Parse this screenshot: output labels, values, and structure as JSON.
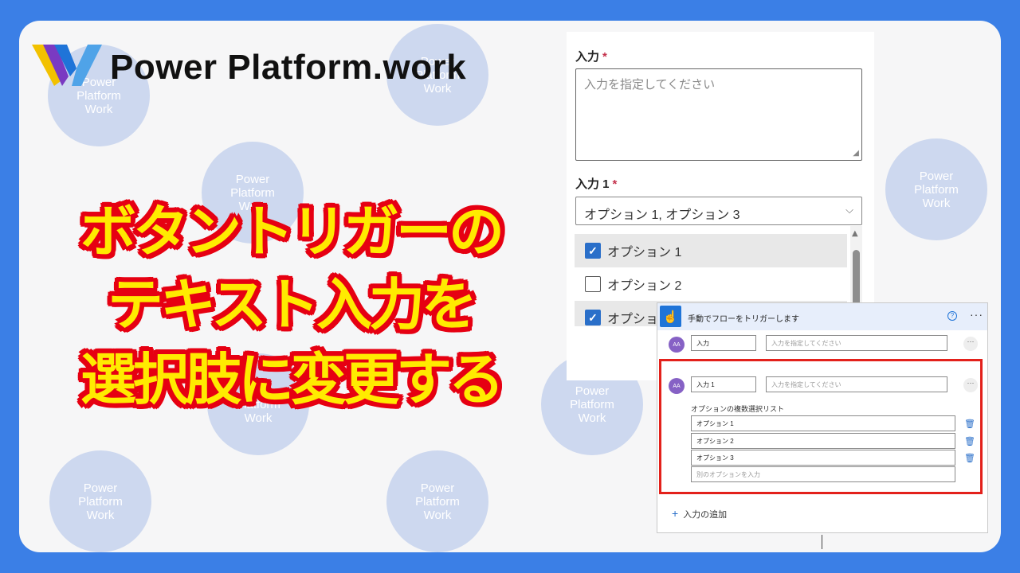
{
  "branding": {
    "site_name": "Power Platform.work",
    "bubble_text": "Power\nPlatform\nWork"
  },
  "headline": {
    "line1": "ボタントリガーの",
    "line2": "テキスト入力を",
    "line3": "選択肢に変更する"
  },
  "form_preview": {
    "field1_label": "入力",
    "field1_required": "*",
    "field1_placeholder": "入力を指定してください",
    "field2_label": "入力 1",
    "field2_required": "*",
    "field2_value": "オプション 1, オプション 3",
    "options": [
      {
        "label": "オプション 1",
        "checked": true
      },
      {
        "label": "オプション 2",
        "checked": false
      },
      {
        "label": "オプション 3",
        "checked": true
      }
    ]
  },
  "trigger_card": {
    "title": "手動でフローをトリガーします",
    "help_icon": "?",
    "more": "···",
    "input1": {
      "avatar": "AA",
      "name": "入力",
      "placeholder": "入力を指定してください"
    },
    "input2": {
      "avatar": "AA",
      "name": "入力 1",
      "placeholder": "入力を指定してください"
    },
    "option_list_label": "オプションの複数選択リスト",
    "option_items": [
      "オプション 1",
      "オプション 2",
      "オプション 3"
    ],
    "new_option_placeholder": "別のオプションを入力",
    "add_input_label": "入力の追加",
    "add_icon": "+"
  },
  "colors": {
    "frame_blue": "#3b7fe6",
    "headline_yellow": "#ffeb00",
    "headline_outline": "#e60012",
    "highlight_red": "#e3211b",
    "checkbox_blue": "#2a6fc9"
  }
}
